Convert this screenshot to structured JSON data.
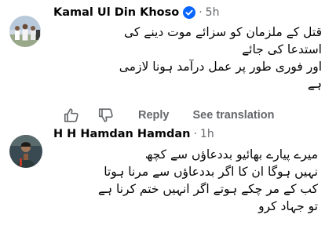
{
  "comments": [
    {
      "author": "Kamal Ul Din Khoso",
      "verified": true,
      "separator": "·",
      "time": "5h",
      "lines": [
        "قتل کے ملزمان کو سزائے موت دینے کی",
        "استدعا کی جائے",
        "اور فوری طور پر عمل درآمد ہونا لازمی",
        "ہے"
      ],
      "actions": {
        "like_icon": "thumbs-up-icon",
        "dislike_icon": "thumbs-down-icon",
        "reply_label": "Reply",
        "translate_label": "See translation"
      }
    },
    {
      "author": "H H Hamdan Hamdan",
      "verified": false,
      "separator": "·",
      "time": "1h",
      "lines": [
        "میرے پیارے بھائیو بددعاؤں سے کچھ",
        "نہیں ہوگا ان کا اگر بددعاؤں سے مرنا ہوتا",
        "کب کے مر چکے ہوتے اگر انہیں ختم کرنا ہے",
        "تو جہاد کرو"
      ]
    }
  ],
  "colors": {
    "verified_badge": "#0866ff",
    "meta_text": "#65676b",
    "body_text": "#050505"
  }
}
